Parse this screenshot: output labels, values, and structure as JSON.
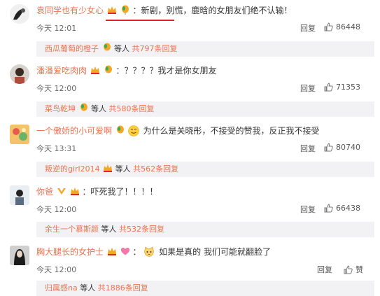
{
  "comments": [
    {
      "user": "袁同学也有少女心",
      "text": "：新剧，别慌，鹿晗的女朋友们绝不认输！",
      "time": "今天 12:01",
      "reply": "回复",
      "likes": "86448",
      "sub": {
        "user": "西瓜葡萄的橙子",
        "middle": "等人",
        "count": "共797条回复"
      }
    },
    {
      "user": "潘潘爱吃肉肉",
      "text": "：？？？？我才是你女朋友",
      "time": "今天 12:00",
      "reply": "回复",
      "likes": "71353",
      "sub": {
        "user": "菜鸟乾坤",
        "middle": "等人",
        "count": "共580条回复"
      }
    },
    {
      "user": "一个傲娇的小可爱啊",
      "text": "为什么是关晓彤，不接受的赞我，反正我不接受",
      "time": "今天 13:31",
      "reply": "回复",
      "likes": "80740",
      "sub": {
        "user": "叛逆的girl2014",
        "middle": "等人",
        "count": "共562条回复"
      }
    },
    {
      "user": "你爸",
      "text": "：吓死我了！！！！",
      "time": "今天 12:00",
      "reply": "回复",
      "likes": "66438",
      "sub": {
        "user": "余生一个慕斯颜",
        "middle": "等人",
        "count": "共532条回复"
      }
    },
    {
      "user": "胸大腿长的女护士",
      "text": "如果是真的 我们可能就翻脸了",
      "time": "今天 12:00",
      "reply": "回复",
      "likes": "赞",
      "sub": {
        "user": "归属感na",
        "middle": "等人",
        "count": "共1886条回复"
      }
    }
  ],
  "colors": {
    "username": "#eb7350",
    "underline": "#e0242b",
    "sub_bg": "#f2f2f5"
  },
  "icons": {
    "like": "thumbs-up-icon",
    "badge_vip": "crown-badge-icon",
    "badge_balloon": "balloon-badge-icon",
    "badge_heart": "heart-badge-icon",
    "emoji_smile": "smile-emoji-icon",
    "emoji_cat": "cat-emoji-icon"
  }
}
